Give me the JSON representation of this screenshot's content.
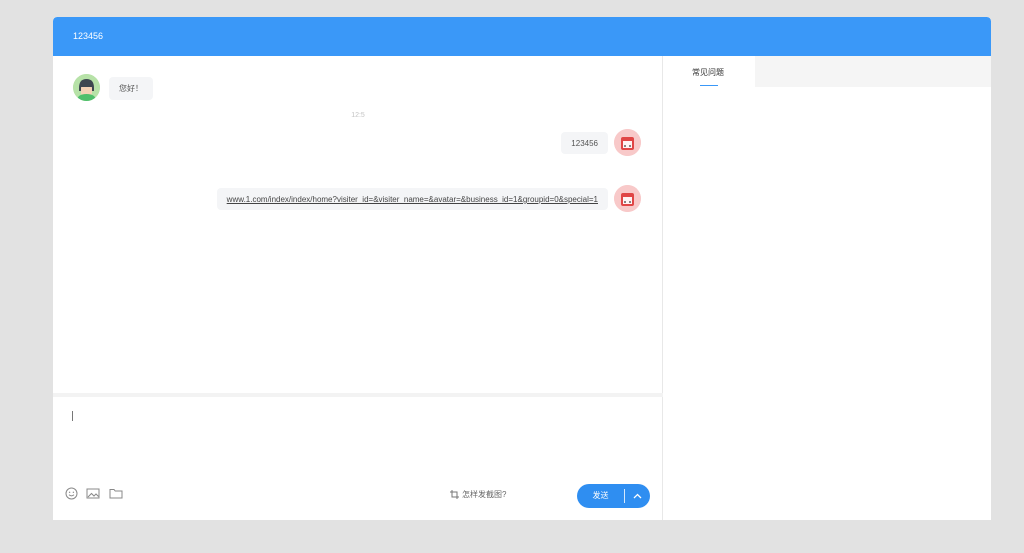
{
  "window": {
    "title": "123456"
  },
  "messages": [
    {
      "sender": "agent",
      "text": "您好！"
    },
    {
      "type": "time",
      "text": "12:5"
    },
    {
      "sender": "visitor",
      "text": "123456"
    },
    {
      "sender": "visitor",
      "text": "www.1.com/index/index/home?visiter_id=&visiter_name=&avatar=&business_id=1&groupid=0&special=1"
    }
  ],
  "toolbar": {
    "emoji_icon": "smile-icon",
    "image_icon": "image-icon",
    "file_icon": "folder-icon",
    "screenshot_help": "怎样发截图?",
    "send_label": "发送",
    "send_more_icon": "chevron-up-icon"
  },
  "side_panel": {
    "tabs": [
      {
        "label": "常见问题",
        "active": true
      }
    ]
  },
  "colors": {
    "primary": "#3a98f8",
    "send_button": "#2f8ef1",
    "background": "#e2e2e2"
  }
}
